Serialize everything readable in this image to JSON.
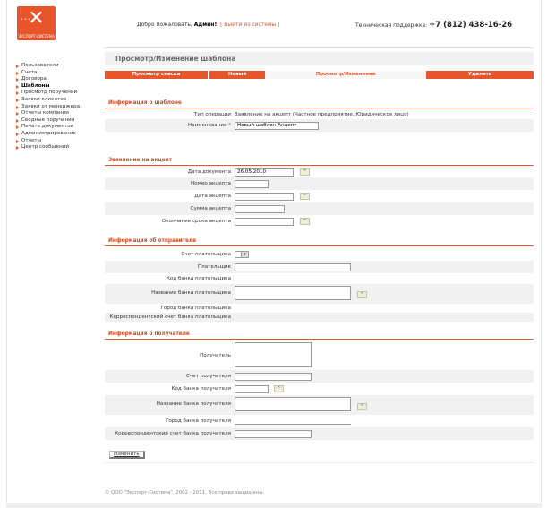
{
  "logo": {
    "brand_text": "ЭКСПОРТ-СИСТЕМА"
  },
  "header": {
    "welcome_prefix": "Добро пожаловать,",
    "user": "Админ!",
    "logout_link": "[ Выйти из системы ]",
    "support_label": "Техническая поддержка:",
    "support_phone": "+7 (812) 438-16-26"
  },
  "sidebar": {
    "items": [
      {
        "label": "Пользователи"
      },
      {
        "label": "Счета"
      },
      {
        "label": "Договора"
      },
      {
        "label": "Шаблоны",
        "active": true
      },
      {
        "label": "Просмотр поручений"
      },
      {
        "label": "Заявки клиентов"
      },
      {
        "label": "Заявки от менеджера"
      },
      {
        "label": "Отчеты компании"
      },
      {
        "label": "Сводные поручения"
      },
      {
        "label": "Печать документов"
      },
      {
        "label": "Администрирование"
      },
      {
        "label": "Отчеты"
      },
      {
        "label": "Центр сообщений"
      }
    ]
  },
  "page": {
    "title": "Просмотр/Изменение шаблона",
    "tabs": [
      {
        "label": "Просмотр списка"
      },
      {
        "label": "Новый"
      },
      {
        "label": "Просмотр/Изменения",
        "current": true
      },
      {
        "label": "Удалить"
      }
    ]
  },
  "template_info": {
    "section_title": "Информация о шаблоне",
    "operation_label": "Тип операции",
    "operation_value": "Заявление на акцепт (Частное предприятие, Юридическое лицо)",
    "name_label": "Наименование",
    "name_required": "*",
    "name_value": "Новый шаблон Акцепт"
  },
  "acceptance": {
    "section_title": "Заявление на акцепт",
    "doc_date_label": "Дата документа",
    "doc_date_value": "26.05.2010",
    "accept_number_label": "Номер акцепта",
    "accept_date_label": "Дата акцепта",
    "accept_sum_label": "Сумма акцепта",
    "accept_end_label": "Окончание срока акцепта"
  },
  "sender": {
    "section_title": "Информация об отправителе",
    "payer_account_label": "Счет плательщика",
    "payer_label": "Плательщик",
    "payer_bank_code_label": "Код банка плательщика",
    "payer_bank_name_label": "Название банка плательщика",
    "payer_bank_city_label": "Город банка плательщика",
    "payer_corr_account_label": "Корреспондентский счет банка плательщика"
  },
  "receiver": {
    "section_title": "Информация о получателе",
    "recipient_label": "Получатель",
    "recipient_account_label": "Счет получателя",
    "recipient_bank_code_label": "Код банка получателя",
    "recipient_bank_name_label": "Название банка получателя",
    "recipient_bank_city_label": "Город банка получателя",
    "recipient_corr_account_label": "Корреспондентский счет банка получателя"
  },
  "actions": {
    "edit_button": "Изменить"
  },
  "footer": {
    "copyright": "© ООО \"Экспорт-Система\", 2002 - 2011. Все права защищены."
  },
  "colors": {
    "accent": "#e8542b",
    "section_text": "#d24a22",
    "shade_row": "#f1f1f1"
  },
  "icons": {
    "calendar_button": "calendar-icon",
    "dropdown": "chevron-down-icon",
    "sidebar_bullet": "triangle-right-icon"
  }
}
